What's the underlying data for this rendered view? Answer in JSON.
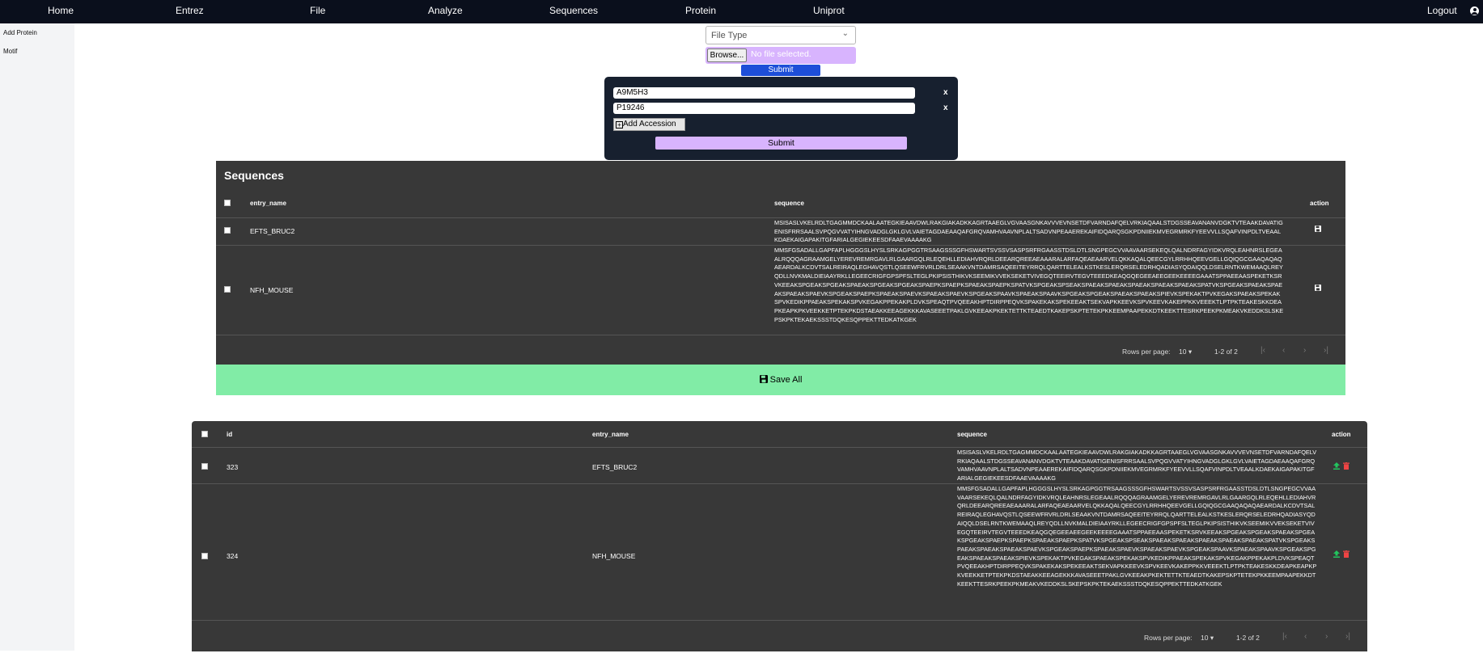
{
  "topnav": {
    "items": [
      "Home",
      "Entrez",
      "File",
      "Analyze",
      "Sequences",
      "Protein",
      "Uniprot"
    ],
    "logout": "Logout"
  },
  "sidebar": {
    "items": [
      "Add Protein",
      "Motif"
    ]
  },
  "upload": {
    "file_type_placeholder": "File Type",
    "browse_label": "Browse...",
    "no_file_text": "No file selected.",
    "submit_label": "Submit"
  },
  "accession_panel": {
    "inputs": [
      "A9M5H3",
      "P19246"
    ],
    "remove_label": "x",
    "add_label": "Add Accession",
    "submit_label": "Submit"
  },
  "sequences_table": {
    "title": "Sequences",
    "columns": [
      "entry_name",
      "sequence",
      "action"
    ],
    "rows": [
      {
        "entry_name": "EFTS_BRUC2",
        "sequence": "MSISASLVKELRDLTGAGMMDCKAALAATEGKIEAAVDWLRAKGIAKADKKAGRTAAEGLVGVAASGNKAVVVEVNSETDFVARNDAFQELVRKIAQAALSTDGSSEAVANANVDGKTVTEAAKDAVATIGENISFRRSAALSVPQGVVATYIHNGVADGLGKLGVLVAIETAGDAEAAQAFGRQVAMHVAAVNPLALTSADVNPEAAEREKAIFIDQARQSGKPDNIIEKMVEGRMRKFYEEVVLLSQAFVINPDLTVEAALKDAEKAIGAPAKITGFARIALGEGIEKEESDFAAEVAAAAKG"
      },
      {
        "entry_name": "NFH_MOUSE",
        "sequence": "MMSFGSADALLGAPFAPLHGGGSLHYSLSRKAGPGGTRSAAGSSSGFHSWARTSVSSVSASPSRFRGAASSTDSLDTLSNGPEGCVVAAVAARSEKEQLQALNDRFAGYIDKVRQLEAHNRSLEGEAALRQQQAGRAAMGELYEREVREMRGAVLRLGAARGQLRLEQEHLLEDIAHVRQRLDEEARQREEAEAAARALARFAQEAEAARVELQKKAQALQEECGYLRRHHQEEVGELLGQIQGCGAAQAQAQAEARDALKCDVTSALREIRAQLEGHAVQSTLQSEEWFRVRLDRLSEAAKVNTDAMRSAQEEITEYRRQLQARTTELEALKSTKESLERQRSELEDRHQADIASYQDAIQQLDSELRNTKWEMAAQLREYQDLLNVKMALDIEIAAYRKLLEGEECRIGFGPSPFSLTEGLPKIPSISTHIKVKSEEMIKVVEKSEKETVIVEGQTEEIRVTEGVTEEEDKEAQGQEGEEAEEGEEKEEEEGAAATSPPAEEAASPEKETKSRVKEEAKSPGEAKSPGEAKSPAEAKSPGEAKSPGEAKSPAEPKSPAEPKSPAEAKSPAEPKSPATVKSPGEAKSPSEAKSPAEAKSPAEAKSPAEAKSPAEAKSPAEAKSPATVKSPGEAKSPAEAKSPAEAKSPAEAKSPAEVKSPGEAKSPAEPKSPAEAKSPAEVKSPAEAKSPAEVKSPGEAKSPAAVKSPAEAKSPAAVKSPGEAKSPGEAKSPAEAKSPAEAKSPIEVKSPEKAKTPVKEGAKSPAEAKSPEKAKSPVKEDIKPPAEAKSPEKAKSPVKEGAKPPEKAKPLDVKSPEAQTPVQEEAKHPTDIRPPEQVKSPAKEKAKSPEKEEAKTSEKVAPKKEEVKSPVKEEVKAKEPPKKVEEEKTLPTPKTEAKESKKDEAPKEAPKPKVEEKKETPTEKPKDSTAEAKKEEAGEKKKAVASEEETPAKLGVKEEAKPKEKTETTKTEAEDTKAKEPSKPTETEKPKKEEMPAAPEKKDTKEEKTTESRKPEEKPKMEAKVKEDDKSLSKEPSKPKTEKAEKSSSTDQKESQPPEKTTEDKATKGEK"
      }
    ],
    "footer": {
      "rows_per_page_label": "Rows per page:",
      "rows_per_page": "10",
      "range": "1-2 of 2"
    }
  },
  "save_all_label": "Save All",
  "saved_table": {
    "columns": [
      "id",
      "entry_name",
      "sequence",
      "action"
    ],
    "rows": [
      {
        "id": "323",
        "entry_name": "EFTS_BRUC2",
        "sequence": "MSISASLVKELRDLTGAGMMDCKAALAATEGKIEAAVDWLRAKGIAKADKKAGRTAAEGLVGVAASGNKAVVVEVNSETDFVARNDAFQELVRKIAQAALSTDGSSEAVANANVDGKTVTEAAKDAVATIGENISFRRSAALSVPQGVVATYIHNGVADGLGKLGVLVAIETAGDAEAAQAFGRQVAMHVAAVNPLALTSADVNPEAAEREKAIFIDQARQSGKPDNIIEKMVEGRMRKFYEEVVLLSQAFVINPDLTVEAALKDAEKAIGAPAKITGFARIALGEGIEKEESDFAAEVAAAAKG"
      },
      {
        "id": "324",
        "entry_name": "NFH_MOUSE",
        "sequence": "MMSFGSADALLGAPFAPLHGGGSLHYSLSRKAGPGGTRSAAGSSSGFHSWARTSVSSVSASPSRFRGAASSTDSLDTLSNGPEGCVVAAVAARSEKEQLQALNDRFAGYIDKVRQLEAHNRSLEGEAALRQQQAGRAAMGELYEREVREMRGAVLRLGAARGQLRLEQEHLLEDIAHVRQRLDEEARQREEAEAAARALARFAQEAEAARVELQKKAQALQEECGYLRRHHQEEVGELLGQIQGCGAAQAQAQAEARDALKCDVTSALREIRAQLEGHAVQSTLQSEEWFRVRLDRLSEAAKVNTDAMRSAQEEITEYRRQLQARTTELEALKSTKESLERQRSELEDRHQADIASYQDAIQQLDSELRNTKWEMAAQLREYQDLLNVKMALDIEIAAYRKLLEGEECRIGFGPSPFSLTEGLPKIPSISTHIKVKSEEMIKVVEKSEKETVIVEGQTEEIRVTEGVTEEEDKEAQGQEGEEAEEGEEKEEEEGAAATSPPAEEAASPEKETKSRVKEEAKSPGEAKSPGEAKSPAEAKSPGEAKSPGEAKSPAEPKSPAEPKSPAEAKSPAEPKSPATVKSPGEAKSPSEAKSPAEAKSPAEAKSPAEAKSPAEAKSPAEAKSPATVKSPGEAKSPAEAKSPAEAKSPAEAKSPAEVKSPGEAKSPAEPKSPAEAKSPAEVKSPAEAKSPAEVKSPGEAKSPAAVKSPAEAKSPAAVKSPGEAKSPGEAKSPAEAKSPAEAKSPIEVKSPEKAKTPVKEGAKSPAEAKSPEKAKSPVKEDIKPPAEAKSPEKAKSPVKEGAKPPEKAKPLDVKSPEAQTPVQEEAKHPTDIRPPEQVKSPAKEKAKSPEKEEAKTSEKVAPKKEEVKSPVKEEVKAKEPPKKVEEEKTLPTPKTEAKESKKDEAPKEAPKPKVEEKKETPTEKPKDSTAEAKKEEAGEKKKAVASEEETPAKLGVKEEAKPKEKTETTKTEAEDTKAKEPSKPTETEKPKKEEMPAAPEKKDTKEEKTTESRKPEEKPKMEAKVKEDDKSLSKEPSKPKTEKAEKSSSTDQKESQPPEKTTEDKATKGEK"
      }
    ],
    "footer": {
      "rows_per_page_label": "Rows per page:",
      "rows_per_page": "10",
      "range": "1-2 of 2"
    }
  },
  "icons": {
    "save": "floppy-disk-icon",
    "upload": "upload-icon",
    "delete": "trash-icon",
    "account": "user-circle-icon"
  },
  "colors": {
    "nav": "#0a0f1c",
    "card": "#383838",
    "save_all": "#81eca6",
    "accent_purple": "#d8b4fe",
    "submit_blue": "#1d4ed8"
  }
}
